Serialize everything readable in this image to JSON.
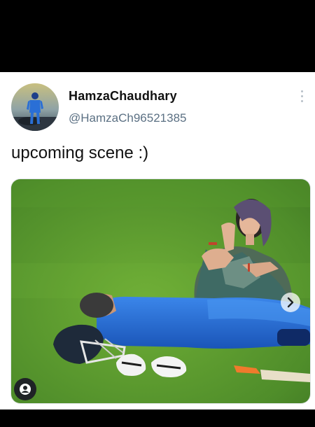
{
  "author": {
    "display_name": "HamzaChaudhary",
    "handle": "@HamzaCh96521385",
    "avatar_icon": "cricketer-avatar-icon"
  },
  "tweet": {
    "text": "upcoming scene :)"
  },
  "media": {
    "next_icon": "chevron-right-icon",
    "alt_icon": "person-circle-icon"
  },
  "menu": {
    "icon": "more-vertical-icon"
  },
  "colors": {
    "background": "#000000",
    "card": "#ffffff",
    "name": "#111111",
    "handle": "#5b7083",
    "field": "#5f9a2e",
    "jersey": "#1f63c9"
  }
}
